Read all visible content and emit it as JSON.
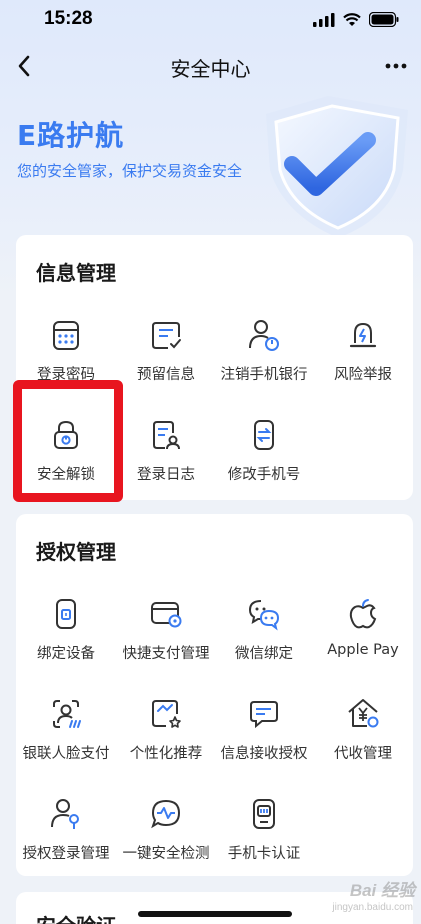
{
  "status_bar": {
    "time": "15:28"
  },
  "nav": {
    "title": "安全中心"
  },
  "hero": {
    "title": "E路护航",
    "subtitle": "您的安全管家，保护交易资金安全"
  },
  "info_section": {
    "title": "信息管理",
    "items": [
      {
        "label": "登录密码",
        "icon": "keypad-icon"
      },
      {
        "label": "预留信息",
        "icon": "message-check-icon"
      },
      {
        "label": "注销手机银行",
        "icon": "user-power-icon"
      },
      {
        "label": "风险举报",
        "icon": "alert-bell-icon"
      },
      {
        "label": "安全解锁",
        "icon": "lock-icon"
      },
      {
        "label": "登录日志",
        "icon": "log-user-icon"
      },
      {
        "label": "修改手机号",
        "icon": "phone-swap-icon"
      }
    ]
  },
  "auth_section": {
    "title": "授权管理",
    "items": [
      {
        "label": "绑定设备",
        "icon": "device-bind-icon"
      },
      {
        "label": "快捷支付管理",
        "icon": "quick-pay-icon"
      },
      {
        "label": "微信绑定",
        "icon": "wechat-icon"
      },
      {
        "label": "Apple Pay",
        "icon": "apple-icon"
      },
      {
        "label": "银联人脸支付",
        "icon": "face-pay-icon"
      },
      {
        "label": "个性化推荐",
        "icon": "recommend-icon"
      },
      {
        "label": "信息接收授权",
        "icon": "message-auth-icon"
      },
      {
        "label": "代收管理",
        "icon": "collection-icon"
      },
      {
        "label": "授权登录管理",
        "icon": "user-key-icon"
      },
      {
        "label": "一键安全检测",
        "icon": "scan-icon"
      },
      {
        "label": "手机卡认证",
        "icon": "sim-card-icon"
      }
    ]
  },
  "next_section": {
    "title": "安全验证"
  },
  "watermark": {
    "text": "Bai 经验",
    "sub": "jingyan.baidu.com"
  },
  "colors": {
    "accent": "#3a7bf0",
    "highlight": "#e8151f"
  }
}
